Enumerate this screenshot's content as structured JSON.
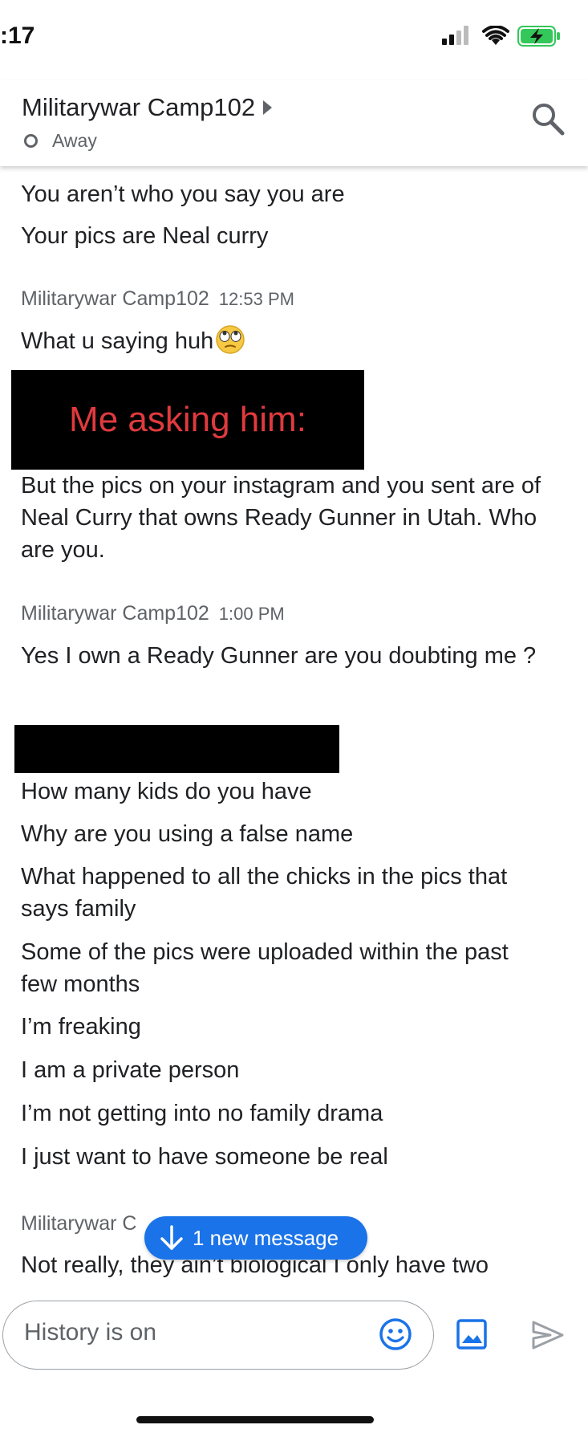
{
  "status_bar": {
    "time": ":17"
  },
  "header": {
    "title": "Militarywar Camp102",
    "presence": "Away"
  },
  "messages": {
    "m1": "You aren’t who you say you are",
    "m2": "Your pics are Neal curry",
    "g1_sender": "Militarywar Camp102",
    "g1_time": "12:53 PM",
    "m3": "What u saying huh",
    "overlay_note": "Me asking him:",
    "m4": "But the pics on your instagram and you sent are of Neal Curry that owns Ready Gunner in Utah. Who are you.",
    "g2_sender": "Militarywar Camp102",
    "g2_time": "1:00 PM",
    "m5": "Yes I own a Ready Gunner are you doubting me ?",
    "m6": "How many kids do you have",
    "m7": "Why are you using a false name",
    "m8": "What happened to all the chicks in the pics that says family",
    "m9": "Some of the pics were uploaded within the past few months",
    "m10": "I’m freaking",
    "m11": "I am a private person",
    "m12": "I’m not getting into no family drama",
    "m13": "I just want to have someone be real",
    "g3_sender": "Militarywar C",
    "m14": "Not really, they ain’t biological I only have two"
  },
  "new_message_pill": {
    "label": "1 new message"
  },
  "compose": {
    "placeholder": "History is on"
  },
  "icons": {
    "search": "search-icon",
    "emoji": "emoji-icon",
    "image": "image-icon",
    "send": "send-icon",
    "arrow_down": "arrow-down-icon"
  },
  "colors": {
    "accent": "#1a73e8",
    "overlay_text": "#e03a3e",
    "battery": "#34c759"
  }
}
